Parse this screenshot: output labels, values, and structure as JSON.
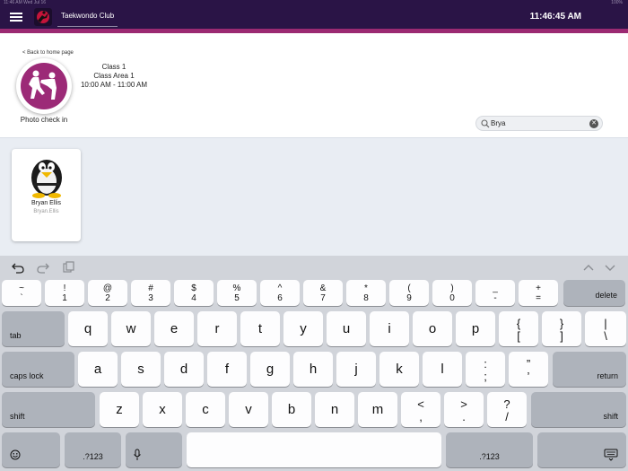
{
  "status_bar": {
    "left": "11:46 AM  Wed Jul 16",
    "right": "100%"
  },
  "header": {
    "club_name": "Taekwondo Club",
    "clock": "11:46:45 AM"
  },
  "panel": {
    "back_link": "< Back to home page",
    "photo_checkin": "Photo check in",
    "class_name": "Class 1",
    "class_area": "Class Area 1",
    "class_time": "10:00 AM - 11:00 AM",
    "search_value": "Brya"
  },
  "members": [
    {
      "name": "Bryan Ellis",
      "username": "Bryan.Ellis"
    }
  ],
  "keyboard": {
    "number_row": [
      {
        "top": "~",
        "bot": "`"
      },
      {
        "top": "!",
        "bot": "1"
      },
      {
        "top": "@",
        "bot": "2"
      },
      {
        "top": "#",
        "bot": "3"
      },
      {
        "top": "$",
        "bot": "4"
      },
      {
        "top": "%",
        "bot": "5"
      },
      {
        "top": "^",
        "bot": "6"
      },
      {
        "top": "&",
        "bot": "7"
      },
      {
        "top": "*",
        "bot": "8"
      },
      {
        "top": "(",
        "bot": "9"
      },
      {
        "top": ")",
        "bot": "0"
      },
      {
        "top": "_",
        "bot": "-"
      },
      {
        "top": "+",
        "bot": "="
      }
    ],
    "delete": "delete",
    "tab": "tab",
    "row1": [
      "q",
      "w",
      "e",
      "r",
      "t",
      "y",
      "u",
      "i",
      "o",
      "p"
    ],
    "row1_sym": [
      {
        "top": "{",
        "bot": "["
      },
      {
        "top": "}",
        "bot": "]"
      },
      {
        "top": "|",
        "bot": "\\"
      }
    ],
    "caps_lock": "caps lock",
    "row2": [
      "a",
      "s",
      "d",
      "f",
      "g",
      "h",
      "j",
      "k",
      "l"
    ],
    "row2_sym": [
      {
        "top": ":",
        "bot": ";"
      },
      {
        "top": "”",
        "bot": "’"
      }
    ],
    "return": "return",
    "shift": "shift",
    "row3": [
      "z",
      "x",
      "c",
      "v",
      "b",
      "n",
      "m"
    ],
    "row3_sym": [
      {
        "top": "<",
        "bot": ","
      },
      {
        "top": ">",
        "bot": "."
      },
      {
        "top": "?",
        "bot": "/"
      }
    ],
    "numbers_key": ".?123",
    "emoji_icon": "emoji-icon",
    "mic_icon": "microphone-icon",
    "dismiss_icon": "keyboard-dismiss-icon"
  }
}
